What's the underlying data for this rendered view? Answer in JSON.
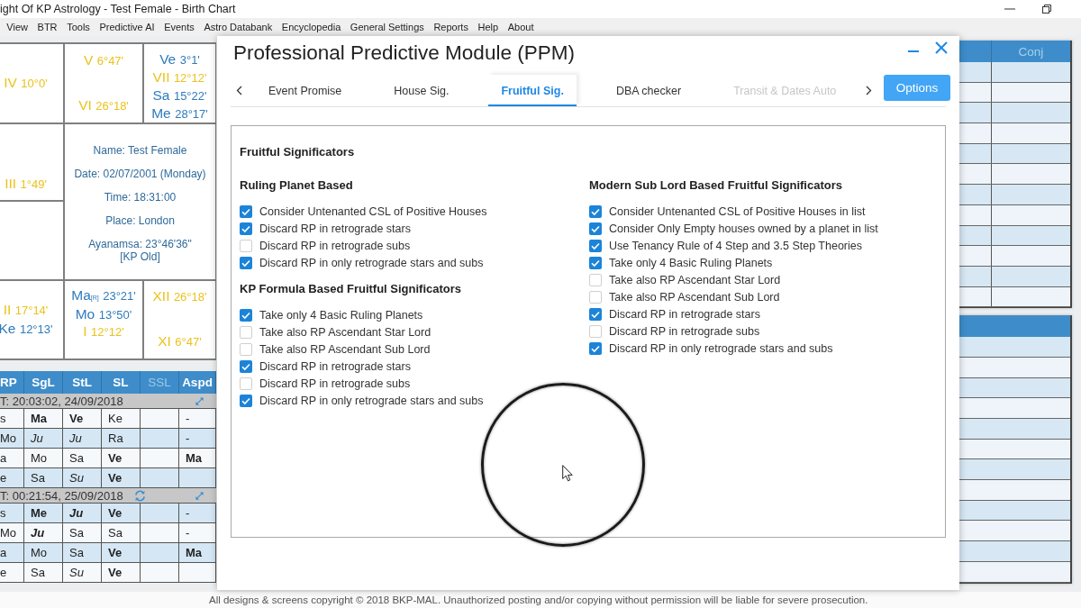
{
  "window": {
    "title": "ight Of KP Astrology - Test Female - Birth Chart"
  },
  "menu": [
    "View",
    "BTR",
    "Tools",
    "Predictive AI",
    "Events",
    "Astro Databank",
    "Encyclopedia",
    "General Settings",
    "Reports",
    "Help",
    "About"
  ],
  "chart": {
    "cells": [
      {
        "entries": [
          {
            "label": "IV",
            "degree": "10°0'",
            "kind": "cusp"
          }
        ]
      },
      {
        "entries": [
          {
            "label": "V",
            "degree": "6°47'",
            "kind": "cusp"
          },
          {
            "label": "VI",
            "degree": "26°18'",
            "kind": "cusp"
          }
        ]
      },
      {
        "entries": [
          {
            "label": "Ve",
            "degree": "3°1'",
            "kind": "planet"
          },
          {
            "label": "VII",
            "degree": "12°12'",
            "kind": "cusp"
          },
          {
            "label": "Sa",
            "degree": "15°22'",
            "kind": "planet"
          },
          {
            "label": "Me",
            "degree": "28°17'",
            "kind": "planet"
          }
        ]
      },
      {
        "entries": [
          {
            "label": "III",
            "degree": "1°49'",
            "kind": "cusp"
          }
        ]
      },
      {},
      {
        "entries": [
          {
            "label": "II",
            "degree": "17°14'",
            "kind": "cusp"
          },
          {
            "label": "Ke",
            "degree": "12°13'",
            "kind": "planet"
          }
        ]
      },
      {
        "entries": [
          {
            "label": "Ma$_{[R]}$",
            "degree": "23°21'",
            "kind": "planet"
          },
          {
            "label": "Mo",
            "degree": "13°50'",
            "kind": "planet"
          },
          {
            "label": "I",
            "degree": "12°12'",
            "kind": "cusp"
          }
        ]
      },
      {
        "entries": [
          {
            "label": "XII",
            "degree": "26°18'",
            "kind": "cusp"
          },
          {
            "label": "XI",
            "degree": "6°47'",
            "kind": "cusp"
          }
        ]
      }
    ],
    "center": [
      "Name: Test Female",
      "Date: 02/07/2001 (Monday)",
      "Time: 18:31:00",
      "Place: London",
      "Ayanamsa: 23°46'36\" [KP Old]"
    ]
  },
  "signif_table": {
    "columns": [
      {
        "label": "RP",
        "disabled": false
      },
      {
        "label": "SgL",
        "disabled": false
      },
      {
        "label": "StL",
        "disabled": false
      },
      {
        "label": "SL",
        "disabled": false
      },
      {
        "label": "SSL",
        "disabled": true
      },
      {
        "label": "Aspd",
        "disabled": false
      }
    ],
    "groups": [
      {
        "heading": "T: 20:03:02, 24/09/2018",
        "refresh": false,
        "rows": [
          {
            "rp": {
              "text": "s",
              "bold": false,
              "italic": false
            },
            "sgl": {
              "text": "Ma",
              "bold": true,
              "italic": false
            },
            "stl": {
              "text": "Ve",
              "bold": true,
              "italic": false
            },
            "sl": {
              "text": "Ke",
              "bold": false,
              "italic": false
            },
            "aspd": {
              "text": "-",
              "bold": false,
              "italic": false
            }
          },
          {
            "rp": {
              "text": "Mo",
              "bold": false,
              "italic": false
            },
            "sgl": {
              "text": "Ju",
              "bold": false,
              "italic": true
            },
            "stl": {
              "text": "Ju",
              "bold": false,
              "italic": true
            },
            "sl": {
              "text": "Ra",
              "bold": false,
              "italic": false
            },
            "aspd": {
              "text": "-",
              "bold": false,
              "italic": false
            }
          },
          {
            "rp": {
              "text": "a",
              "bold": false,
              "italic": false
            },
            "sgl": {
              "text": "Mo",
              "bold": false,
              "italic": false
            },
            "stl": {
              "text": "Sa",
              "bold": false,
              "italic": false
            },
            "sl": {
              "text": "Ve",
              "bold": true,
              "italic": false
            },
            "aspd": {
              "text": "Ma",
              "bold": true,
              "italic": false
            }
          },
          {
            "rp": {
              "text": "e",
              "bold": false,
              "italic": false
            },
            "sgl": {
              "text": "Sa",
              "bold": false,
              "italic": false
            },
            "stl": {
              "text": "Su",
              "bold": false,
              "italic": true
            },
            "sl": {
              "text": "Ve",
              "bold": true,
              "italic": false
            }
          }
        ]
      },
      {
        "heading": "T: 00:21:54, 25/09/2018",
        "refresh": true,
        "rows": [
          {
            "rp": {
              "text": "s",
              "bold": false,
              "italic": false
            },
            "sgl": {
              "text": "Me",
              "bold": true,
              "italic": false
            },
            "stl": {
              "text": "Ju",
              "bold": true,
              "italic": true
            },
            "sl": {
              "text": "Ve",
              "bold": true,
              "italic": false
            },
            "aspd": {
              "text": "-",
              "bold": false,
              "italic": false
            }
          },
          {
            "rp": {
              "text": "Mo",
              "bold": false,
              "italic": false
            },
            "sgl": {
              "text": "Ju",
              "bold": true,
              "italic": true
            },
            "stl": {
              "text": "Sa",
              "bold": false,
              "italic": false
            },
            "sl": {
              "text": "Sa",
              "bold": false,
              "italic": false
            },
            "aspd": {
              "text": "-",
              "bold": false,
              "italic": false
            }
          },
          {
            "rp": {
              "text": "a",
              "bold": false,
              "italic": false
            },
            "sgl": {
              "text": "Mo",
              "bold": false,
              "italic": false
            },
            "stl": {
              "text": "Sa",
              "bold": false,
              "italic": false
            },
            "sl": {
              "text": "Ve",
              "bold": true,
              "italic": false
            },
            "aspd": {
              "text": "Ma",
              "bold": true,
              "italic": false
            }
          },
          {
            "rp": {
              "text": "e",
              "bold": false,
              "italic": false
            },
            "sgl": {
              "text": "Sa",
              "bold": false,
              "italic": false
            },
            "stl": {
              "text": "Su",
              "bold": false,
              "italic": true
            },
            "sl": {
              "text": "Ve",
              "bold": true,
              "italic": false
            }
          }
        ]
      }
    ]
  },
  "right_panel": {
    "columns": [
      {
        "label": "Conj",
        "disabled": true
      }
    ]
  },
  "dialog": {
    "title": "Professional Predictive Module (PPM)",
    "tabs": [
      {
        "label": "Event Promise",
        "selected": false,
        "disabled": false
      },
      {
        "label": "House Sig.",
        "selected": false,
        "disabled": false
      },
      {
        "label": "Fruitful Sig.",
        "selected": true,
        "disabled": false
      },
      {
        "label": "DBA checker",
        "selected": false,
        "disabled": false
      },
      {
        "label": "Transit & Dates Auto",
        "selected": false,
        "disabled": true
      }
    ],
    "options_button": "Options",
    "panel": {
      "heading": "Fruitful Significators",
      "columns": [
        {
          "sections": [
            {
              "heading": "Ruling Planet Based",
              "options": [
                {
                  "label": "Consider Untenanted CSL of Positive Houses",
                  "checked": true
                },
                {
                  "label": "Discard RP in retrograde stars",
                  "checked": true
                },
                {
                  "label": "Discard RP in retrograde subs",
                  "checked": false
                },
                {
                  "label": "Discard RP in only retrograde stars and subs",
                  "checked": true
                }
              ]
            },
            {
              "heading": "KP Formula Based Fruitful Significators",
              "options": [
                {
                  "label": "Take only 4 Basic Ruling Planets",
                  "checked": true
                },
                {
                  "label": "Take also RP Ascendant Star Lord",
                  "checked": false
                },
                {
                  "label": "Take also RP Ascendant Sub Lord",
                  "checked": false
                },
                {
                  "label": "Discard RP in retrograde stars",
                  "checked": true
                },
                {
                  "label": "Discard RP in retrograde subs",
                  "checked": false
                },
                {
                  "label": "Discard RP in only retrograde stars and subs",
                  "checked": true
                }
              ]
            }
          ]
        },
        {
          "sections": [
            {
              "heading": "Modern Sub Lord Based Fruitful Significators",
              "options": [
                {
                  "label": "Consider Untenanted CSL of Positive Houses in list",
                  "checked": true
                },
                {
                  "label": "Consider Only Empty houses owned by a planet in list",
                  "checked": true
                },
                {
                  "label": "Use Tenancy Rule of 4 Step and 3.5 Step Theories",
                  "checked": true
                },
                {
                  "label": "Take only 4 Basic Ruling Planets",
                  "checked": true
                },
                {
                  "label": "Take also RP Ascendant Star Lord",
                  "checked": false
                },
                {
                  "label": "Take also RP Ascendant Sub Lord",
                  "checked": false
                },
                {
                  "label": "Discard RP in retrograde stars",
                  "checked": true
                },
                {
                  "label": "Discard RP in retrograde subs",
                  "checked": false
                },
                {
                  "label": "Discard RP in only retrograde stars and subs",
                  "checked": true
                }
              ]
            }
          ]
        }
      ]
    }
  },
  "footer": "All designs & screens copyright © 2018 BKP-MAL. Unauthorized posting and/or copying without permission will be liable for severe prosecution."
}
